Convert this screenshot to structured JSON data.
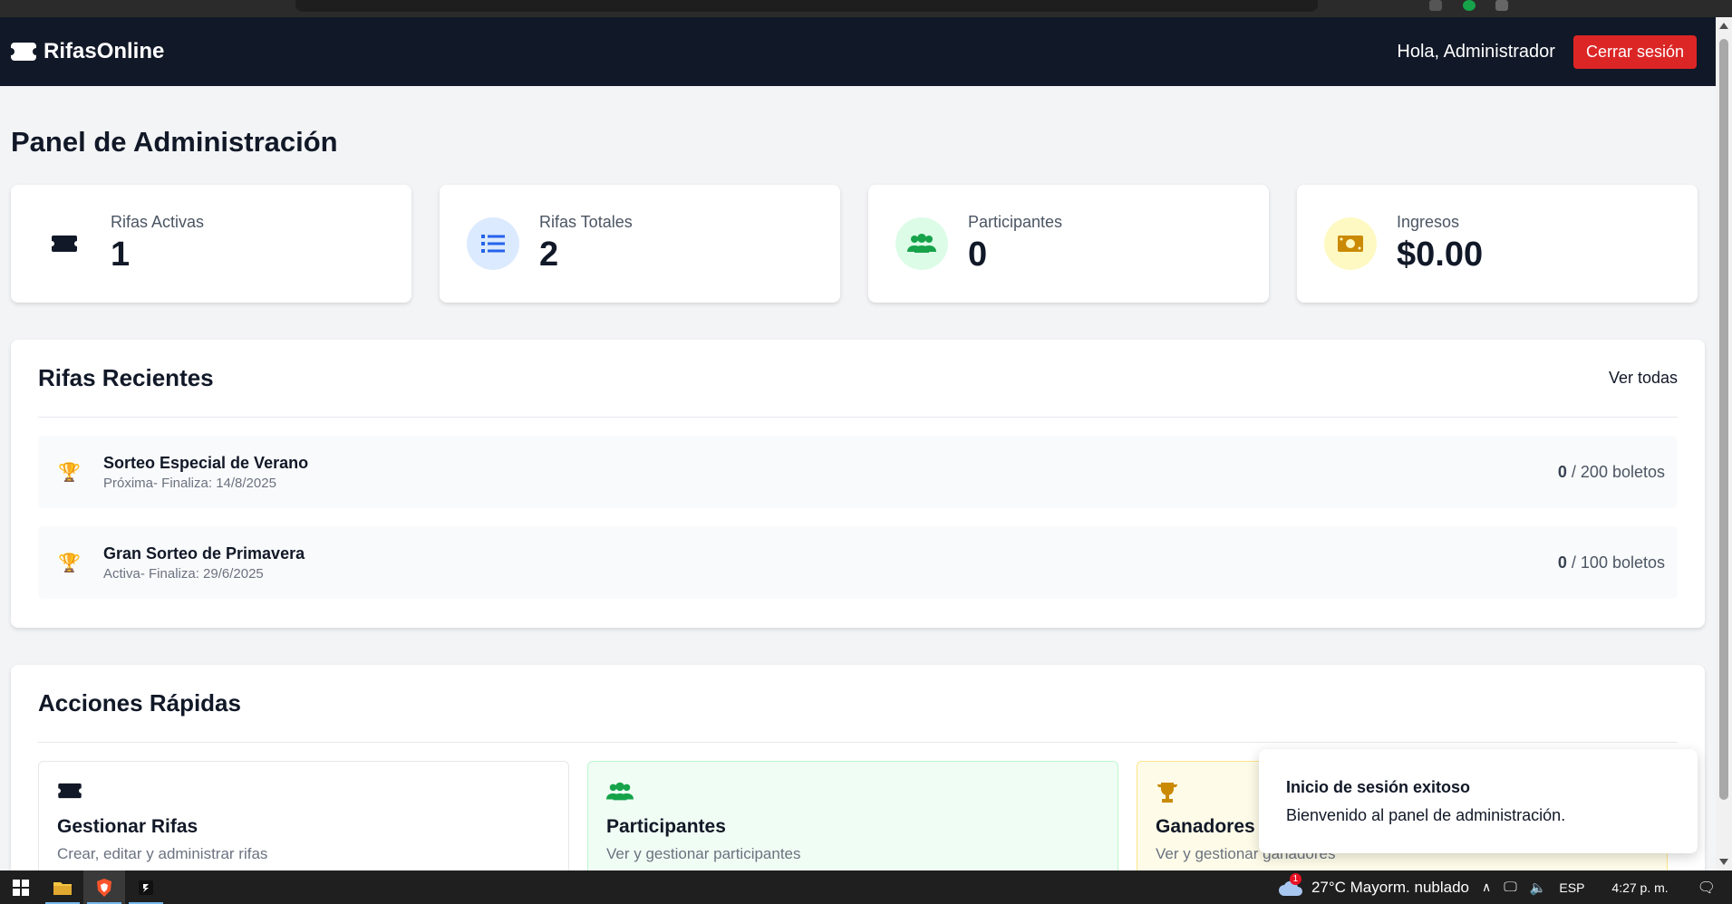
{
  "navbar": {
    "brand": "RifasOnline",
    "greeting": "Hola, Administrador",
    "logout_label": "Cerrar sesión"
  },
  "page": {
    "title": "Panel de Administración"
  },
  "stats": [
    {
      "label": "Rifas Activas",
      "value": "1",
      "icon": "ticket-icon",
      "color": "#111827"
    },
    {
      "label": "Rifas Totales",
      "value": "2",
      "icon": "list-icon",
      "color": "#2563eb"
    },
    {
      "label": "Participantes",
      "value": "0",
      "icon": "users-icon",
      "color": "#16a34a"
    },
    {
      "label": "Ingresos",
      "value": "$0.00",
      "icon": "money-icon",
      "color": "#ca8a04"
    }
  ],
  "recent": {
    "title": "Rifas Recientes",
    "see_all": "Ver todas",
    "items": [
      {
        "name": "Sorteo Especial de Verano",
        "meta": "Próxima- Finaliza: 14/8/2025",
        "sold": "0",
        "total": "/ 200 boletos"
      },
      {
        "name": "Gran Sorteo de Primavera",
        "meta": "Activa- Finaliza: 29/6/2025",
        "sold": "0",
        "total": "/ 100 boletos"
      }
    ]
  },
  "actions": {
    "title": "Acciones Rápidas",
    "items": [
      {
        "title": "Gestionar Rifas",
        "desc": "Crear, editar y administrar rifas",
        "icon": "ticket-icon"
      },
      {
        "title": "Participantes",
        "desc": "Ver y gestionar participantes",
        "icon": "users-icon"
      },
      {
        "title": "Ganadores",
        "desc": "Ver y gestionar ganadores",
        "icon": "trophy-icon"
      }
    ]
  },
  "toast": {
    "title": "Inicio de sesión exitoso",
    "message": "Bienvenido al panel de administración."
  },
  "taskbar": {
    "weather": "27°C  Mayorm. nublado",
    "lang": "ESP",
    "time": "4:27 p. m.",
    "weather_badge": "1"
  }
}
